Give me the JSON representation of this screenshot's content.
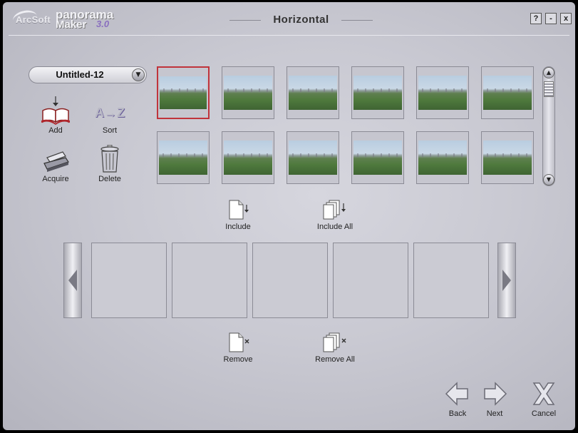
{
  "header": {
    "brand": "ArcSoft",
    "product_line1": "panorama",
    "product_line2": "Maker",
    "version": "3.0",
    "title": "Horizontal",
    "help_label": "?",
    "minimize_label": "-",
    "close_label": "x"
  },
  "project": {
    "name": "Untitled-12",
    "arrow": "▼"
  },
  "tools": {
    "add_label": "Add",
    "sort_label": "Sort",
    "sort_glyph": "A→Z",
    "acquire_label": "Acquire",
    "delete_label": "Delete"
  },
  "scrollbar": {
    "up": "▲",
    "down": "▼"
  },
  "actions": {
    "include_label": "Include",
    "include_all_label": "Include All",
    "remove_label": "Remove",
    "remove_all_label": "Remove All"
  },
  "nav": {
    "back_label": "Back",
    "next_label": "Next",
    "cancel_label": "Cancel"
  },
  "colors": {
    "selection": "#c0333b",
    "accent": "#8a6fbf"
  }
}
